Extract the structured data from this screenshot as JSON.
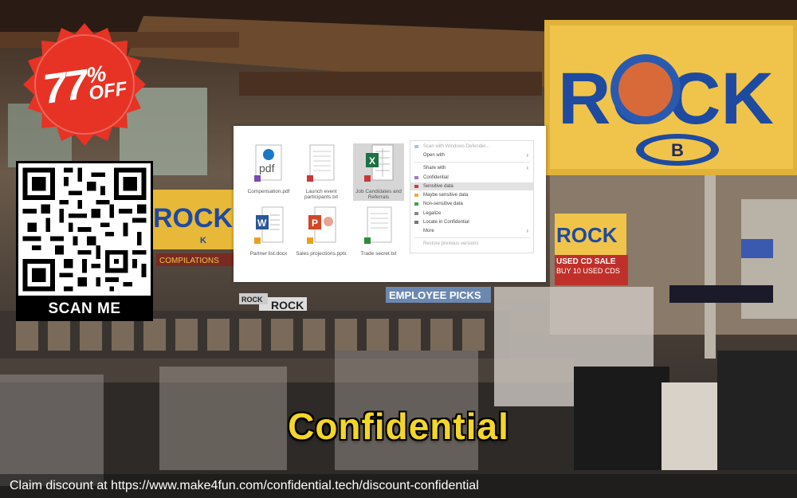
{
  "badge": {
    "percent": "77",
    "symbol": "%",
    "off": "OFF",
    "color": "#e63325"
  },
  "qr": {
    "label": "SCAN ME"
  },
  "background": {
    "signs": {
      "rock_big": "ROCK",
      "rock_big_letter": "B",
      "rock_left": "ROCK",
      "rock_left_letter": "K",
      "rock_right": "ROCK",
      "rock_small": "ROCK",
      "rock_small2": "ROCK",
      "used_cd_sale": "USED CD SALE",
      "buy_10": "BUY 10 USED CDS",
      "employee_picks": "EMPLOYEE PICKS",
      "compilations": "COMPILATIONS"
    }
  },
  "screenshot": {
    "files": [
      {
        "label": "Compensation.pdf",
        "icon": "edge-pdf-icon"
      },
      {
        "label": "Launch event participants.txt",
        "icon": "text-file-icon"
      },
      {
        "label": "Job Candidates and Referrals",
        "icon": "excel-file-icon"
      },
      {
        "label": "Partner list.docx",
        "icon": "word-file-icon"
      },
      {
        "label": "Sales projections.pptx",
        "icon": "powerpoint-file-icon"
      },
      {
        "label": "Trade secret.txt",
        "icon": "text-file-icon"
      }
    ],
    "menu": [
      {
        "label": "Scan with Windows Defender...",
        "arrow": false
      },
      {
        "label": "Open with",
        "arrow": true
      },
      {
        "label": "Share with",
        "arrow": true
      },
      {
        "label": "Confidential",
        "arrow": false
      },
      {
        "label": "Sensitive data",
        "arrow": false,
        "highlight": true
      },
      {
        "label": "Maybe sensitive data",
        "arrow": false
      },
      {
        "label": "Non-sensitive data",
        "arrow": false
      },
      {
        "label": "Legalize",
        "arrow": false
      },
      {
        "label": "Locate in Confidential",
        "arrow": false
      },
      {
        "label": "More",
        "arrow": true
      },
      {
        "label": "Restore previous versions",
        "arrow": false,
        "dim": true
      }
    ]
  },
  "title": "Confidential",
  "footer": "Claim discount at https://www.make4fun.com/confidential.tech/discount-confidential"
}
